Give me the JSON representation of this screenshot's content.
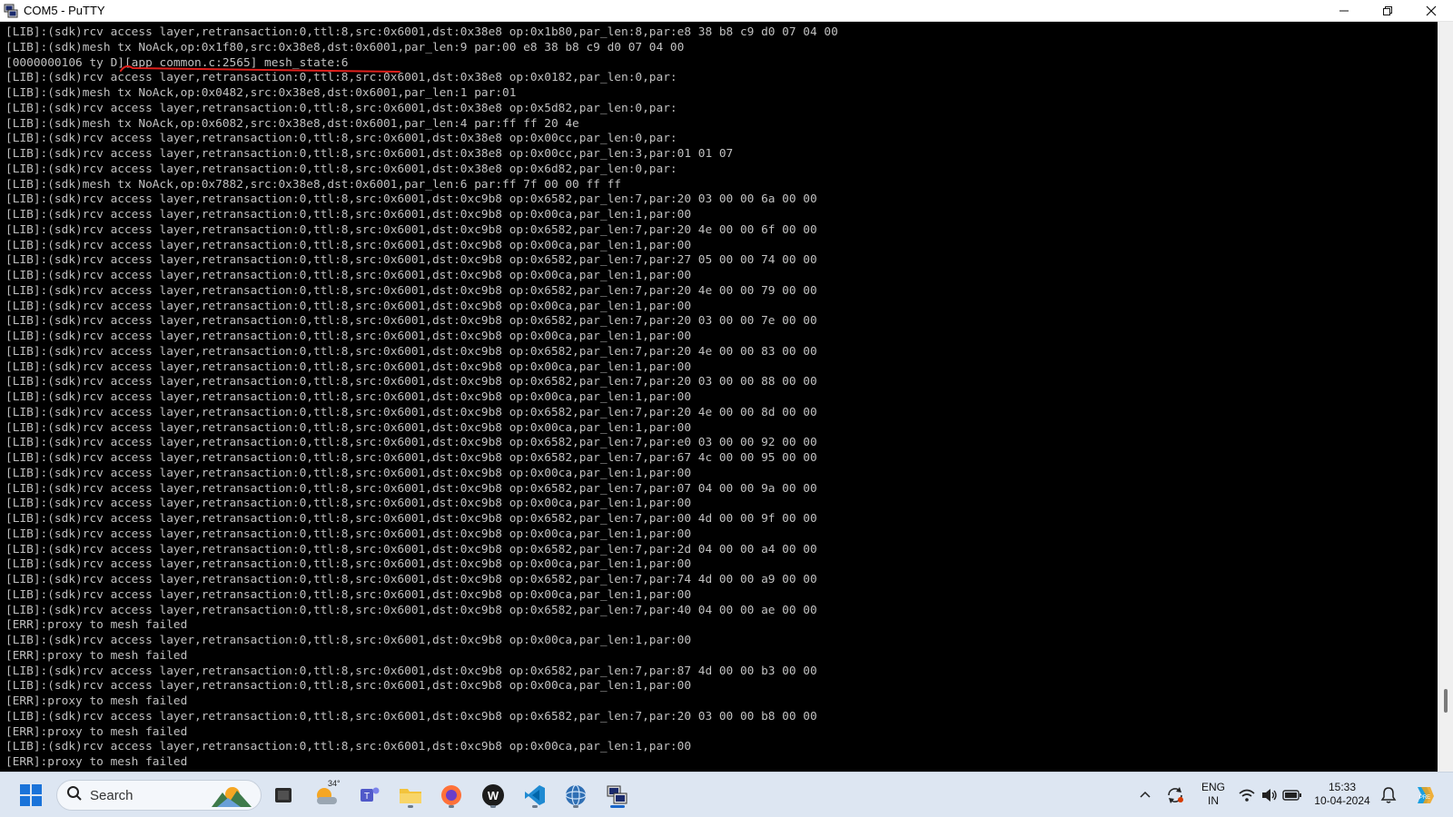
{
  "window": {
    "title": "COM5 - PuTTY",
    "minimize_icon": "minimize-icon",
    "maximize_icon": "restore-icon",
    "close_icon": "close-icon"
  },
  "terminal": {
    "text_color": "#c0c0c0",
    "background": "#000000",
    "annotation_color": "#e0201c",
    "lines": [
      "[LIB]:(sdk)rcv access layer,retransaction:0,ttl:8,src:0x6001,dst:0x38e8 op:0x1b80,par_len:8,par:e8 38 b8 c9 d0 07 04 00",
      "[LIB]:(sdk)mesh tx NoAck,op:0x1f80,src:0x38e8,dst:0x6001,par_len:9 par:00 e8 38 b8 c9 d0 07 04 00",
      "[0000000106 ty D][app_common.c:2565] mesh_state:6",
      "[LIB]:(sdk)rcv access layer,retransaction:0,ttl:8,src:0x6001,dst:0x38e8 op:0x0182,par_len:0,par:",
      "[LIB]:(sdk)mesh tx NoAck,op:0x0482,src:0x38e8,dst:0x6001,par_len:1 par:01",
      "[LIB]:(sdk)rcv access layer,retransaction:0,ttl:8,src:0x6001,dst:0x38e8 op:0x5d82,par_len:0,par:",
      "[LIB]:(sdk)mesh tx NoAck,op:0x6082,src:0x38e8,dst:0x6001,par_len:4 par:ff ff 20 4e",
      "[LIB]:(sdk)rcv access layer,retransaction:0,ttl:8,src:0x6001,dst:0x38e8 op:0x00cc,par_len:0,par:",
      "[LIB]:(sdk)rcv access layer,retransaction:0,ttl:8,src:0x6001,dst:0x38e8 op:0x00cc,par_len:3,par:01 01 07",
      "[LIB]:(sdk)rcv access layer,retransaction:0,ttl:8,src:0x6001,dst:0x38e8 op:0x6d82,par_len:0,par:",
      "[LIB]:(sdk)mesh tx NoAck,op:0x7882,src:0x38e8,dst:0x6001,par_len:6 par:ff 7f 00 00 ff ff",
      "[LIB]:(sdk)rcv access layer,retransaction:0,ttl:8,src:0x6001,dst:0xc9b8 op:0x6582,par_len:7,par:20 03 00 00 6a 00 00",
      "[LIB]:(sdk)rcv access layer,retransaction:0,ttl:8,src:0x6001,dst:0xc9b8 op:0x00ca,par_len:1,par:00",
      "[LIB]:(sdk)rcv access layer,retransaction:0,ttl:8,src:0x6001,dst:0xc9b8 op:0x6582,par_len:7,par:20 4e 00 00 6f 00 00",
      "[LIB]:(sdk)rcv access layer,retransaction:0,ttl:8,src:0x6001,dst:0xc9b8 op:0x00ca,par_len:1,par:00",
      "[LIB]:(sdk)rcv access layer,retransaction:0,ttl:8,src:0x6001,dst:0xc9b8 op:0x6582,par_len:7,par:27 05 00 00 74 00 00",
      "[LIB]:(sdk)rcv access layer,retransaction:0,ttl:8,src:0x6001,dst:0xc9b8 op:0x00ca,par_len:1,par:00",
      "[LIB]:(sdk)rcv access layer,retransaction:0,ttl:8,src:0x6001,dst:0xc9b8 op:0x6582,par_len:7,par:20 4e 00 00 79 00 00",
      "[LIB]:(sdk)rcv access layer,retransaction:0,ttl:8,src:0x6001,dst:0xc9b8 op:0x00ca,par_len:1,par:00",
      "[LIB]:(sdk)rcv access layer,retransaction:0,ttl:8,src:0x6001,dst:0xc9b8 op:0x6582,par_len:7,par:20 03 00 00 7e 00 00",
      "[LIB]:(sdk)rcv access layer,retransaction:0,ttl:8,src:0x6001,dst:0xc9b8 op:0x00ca,par_len:1,par:00",
      "[LIB]:(sdk)rcv access layer,retransaction:0,ttl:8,src:0x6001,dst:0xc9b8 op:0x6582,par_len:7,par:20 4e 00 00 83 00 00",
      "[LIB]:(sdk)rcv access layer,retransaction:0,ttl:8,src:0x6001,dst:0xc9b8 op:0x00ca,par_len:1,par:00",
      "[LIB]:(sdk)rcv access layer,retransaction:0,ttl:8,src:0x6001,dst:0xc9b8 op:0x6582,par_len:7,par:20 03 00 00 88 00 00",
      "[LIB]:(sdk)rcv access layer,retransaction:0,ttl:8,src:0x6001,dst:0xc9b8 op:0x00ca,par_len:1,par:00",
      "[LIB]:(sdk)rcv access layer,retransaction:0,ttl:8,src:0x6001,dst:0xc9b8 op:0x6582,par_len:7,par:20 4e 00 00 8d 00 00",
      "[LIB]:(sdk)rcv access layer,retransaction:0,ttl:8,src:0x6001,dst:0xc9b8 op:0x00ca,par_len:1,par:00",
      "[LIB]:(sdk)rcv access layer,retransaction:0,ttl:8,src:0x6001,dst:0xc9b8 op:0x6582,par_len:7,par:e0 03 00 00 92 00 00",
      "[LIB]:(sdk)rcv access layer,retransaction:0,ttl:8,src:0x6001,dst:0xc9b8 op:0x6582,par_len:7,par:67 4c 00 00 95 00 00",
      "[LIB]:(sdk)rcv access layer,retransaction:0,ttl:8,src:0x6001,dst:0xc9b8 op:0x00ca,par_len:1,par:00",
      "[LIB]:(sdk)rcv access layer,retransaction:0,ttl:8,src:0x6001,dst:0xc9b8 op:0x6582,par_len:7,par:07 04 00 00 9a 00 00",
      "[LIB]:(sdk)rcv access layer,retransaction:0,ttl:8,src:0x6001,dst:0xc9b8 op:0x00ca,par_len:1,par:00",
      "[LIB]:(sdk)rcv access layer,retransaction:0,ttl:8,src:0x6001,dst:0xc9b8 op:0x6582,par_len:7,par:00 4d 00 00 9f 00 00",
      "[LIB]:(sdk)rcv access layer,retransaction:0,ttl:8,src:0x6001,dst:0xc9b8 op:0x00ca,par_len:1,par:00",
      "[LIB]:(sdk)rcv access layer,retransaction:0,ttl:8,src:0x6001,dst:0xc9b8 op:0x6582,par_len:7,par:2d 04 00 00 a4 00 00",
      "[LIB]:(sdk)rcv access layer,retransaction:0,ttl:8,src:0x6001,dst:0xc9b8 op:0x00ca,par_len:1,par:00",
      "[LIB]:(sdk)rcv access layer,retransaction:0,ttl:8,src:0x6001,dst:0xc9b8 op:0x6582,par_len:7,par:74 4d 00 00 a9 00 00",
      "[LIB]:(sdk)rcv access layer,retransaction:0,ttl:8,src:0x6001,dst:0xc9b8 op:0x00ca,par_len:1,par:00",
      "[LIB]:(sdk)rcv access layer,retransaction:0,ttl:8,src:0x6001,dst:0xc9b8 op:0x6582,par_len:7,par:40 04 00 00 ae 00 00",
      "[ERR]:proxy to mesh failed",
      "[LIB]:(sdk)rcv access layer,retransaction:0,ttl:8,src:0x6001,dst:0xc9b8 op:0x00ca,par_len:1,par:00",
      "[ERR]:proxy to mesh failed",
      "[LIB]:(sdk)rcv access layer,retransaction:0,ttl:8,src:0x6001,dst:0xc9b8 op:0x6582,par_len:7,par:87 4d 00 00 b3 00 00",
      "[LIB]:(sdk)rcv access layer,retransaction:0,ttl:8,src:0x6001,dst:0xc9b8 op:0x00ca,par_len:1,par:00",
      "[ERR]:proxy to mesh failed",
      "[LIB]:(sdk)rcv access layer,retransaction:0,ttl:8,src:0x6001,dst:0xc9b8 op:0x6582,par_len:7,par:20 03 00 00 b8 00 00",
      "[ERR]:proxy to mesh failed",
      "[LIB]:(sdk)rcv access layer,retransaction:0,ttl:8,src:0x6001,dst:0xc9b8 op:0x00ca,par_len:1,par:00",
      "[ERR]:proxy to mesh failed"
    ]
  },
  "taskbar": {
    "background": "#dde6f2",
    "search_placeholder": "Search",
    "weather_temp": "34°",
    "language_line1": "ENG",
    "language_line2": "IN",
    "time": "15:33",
    "date": "10-04-2024",
    "apps": [
      {
        "name": "start-icon"
      },
      {
        "name": "task-view-icon"
      },
      {
        "name": "weather-widget-icon"
      },
      {
        "name": "teams-icon"
      },
      {
        "name": "file-explorer-icon"
      },
      {
        "name": "firefox-icon"
      },
      {
        "name": "wireshark-icon"
      },
      {
        "name": "vscode-icon"
      },
      {
        "name": "globe-app-icon"
      },
      {
        "name": "putty-icon"
      }
    ],
    "tray": [
      "chevron-up-icon",
      "sync-icon",
      "wifi-icon",
      "volume-icon",
      "battery-icon",
      "notification-bell-icon",
      "copilot-icon"
    ]
  }
}
